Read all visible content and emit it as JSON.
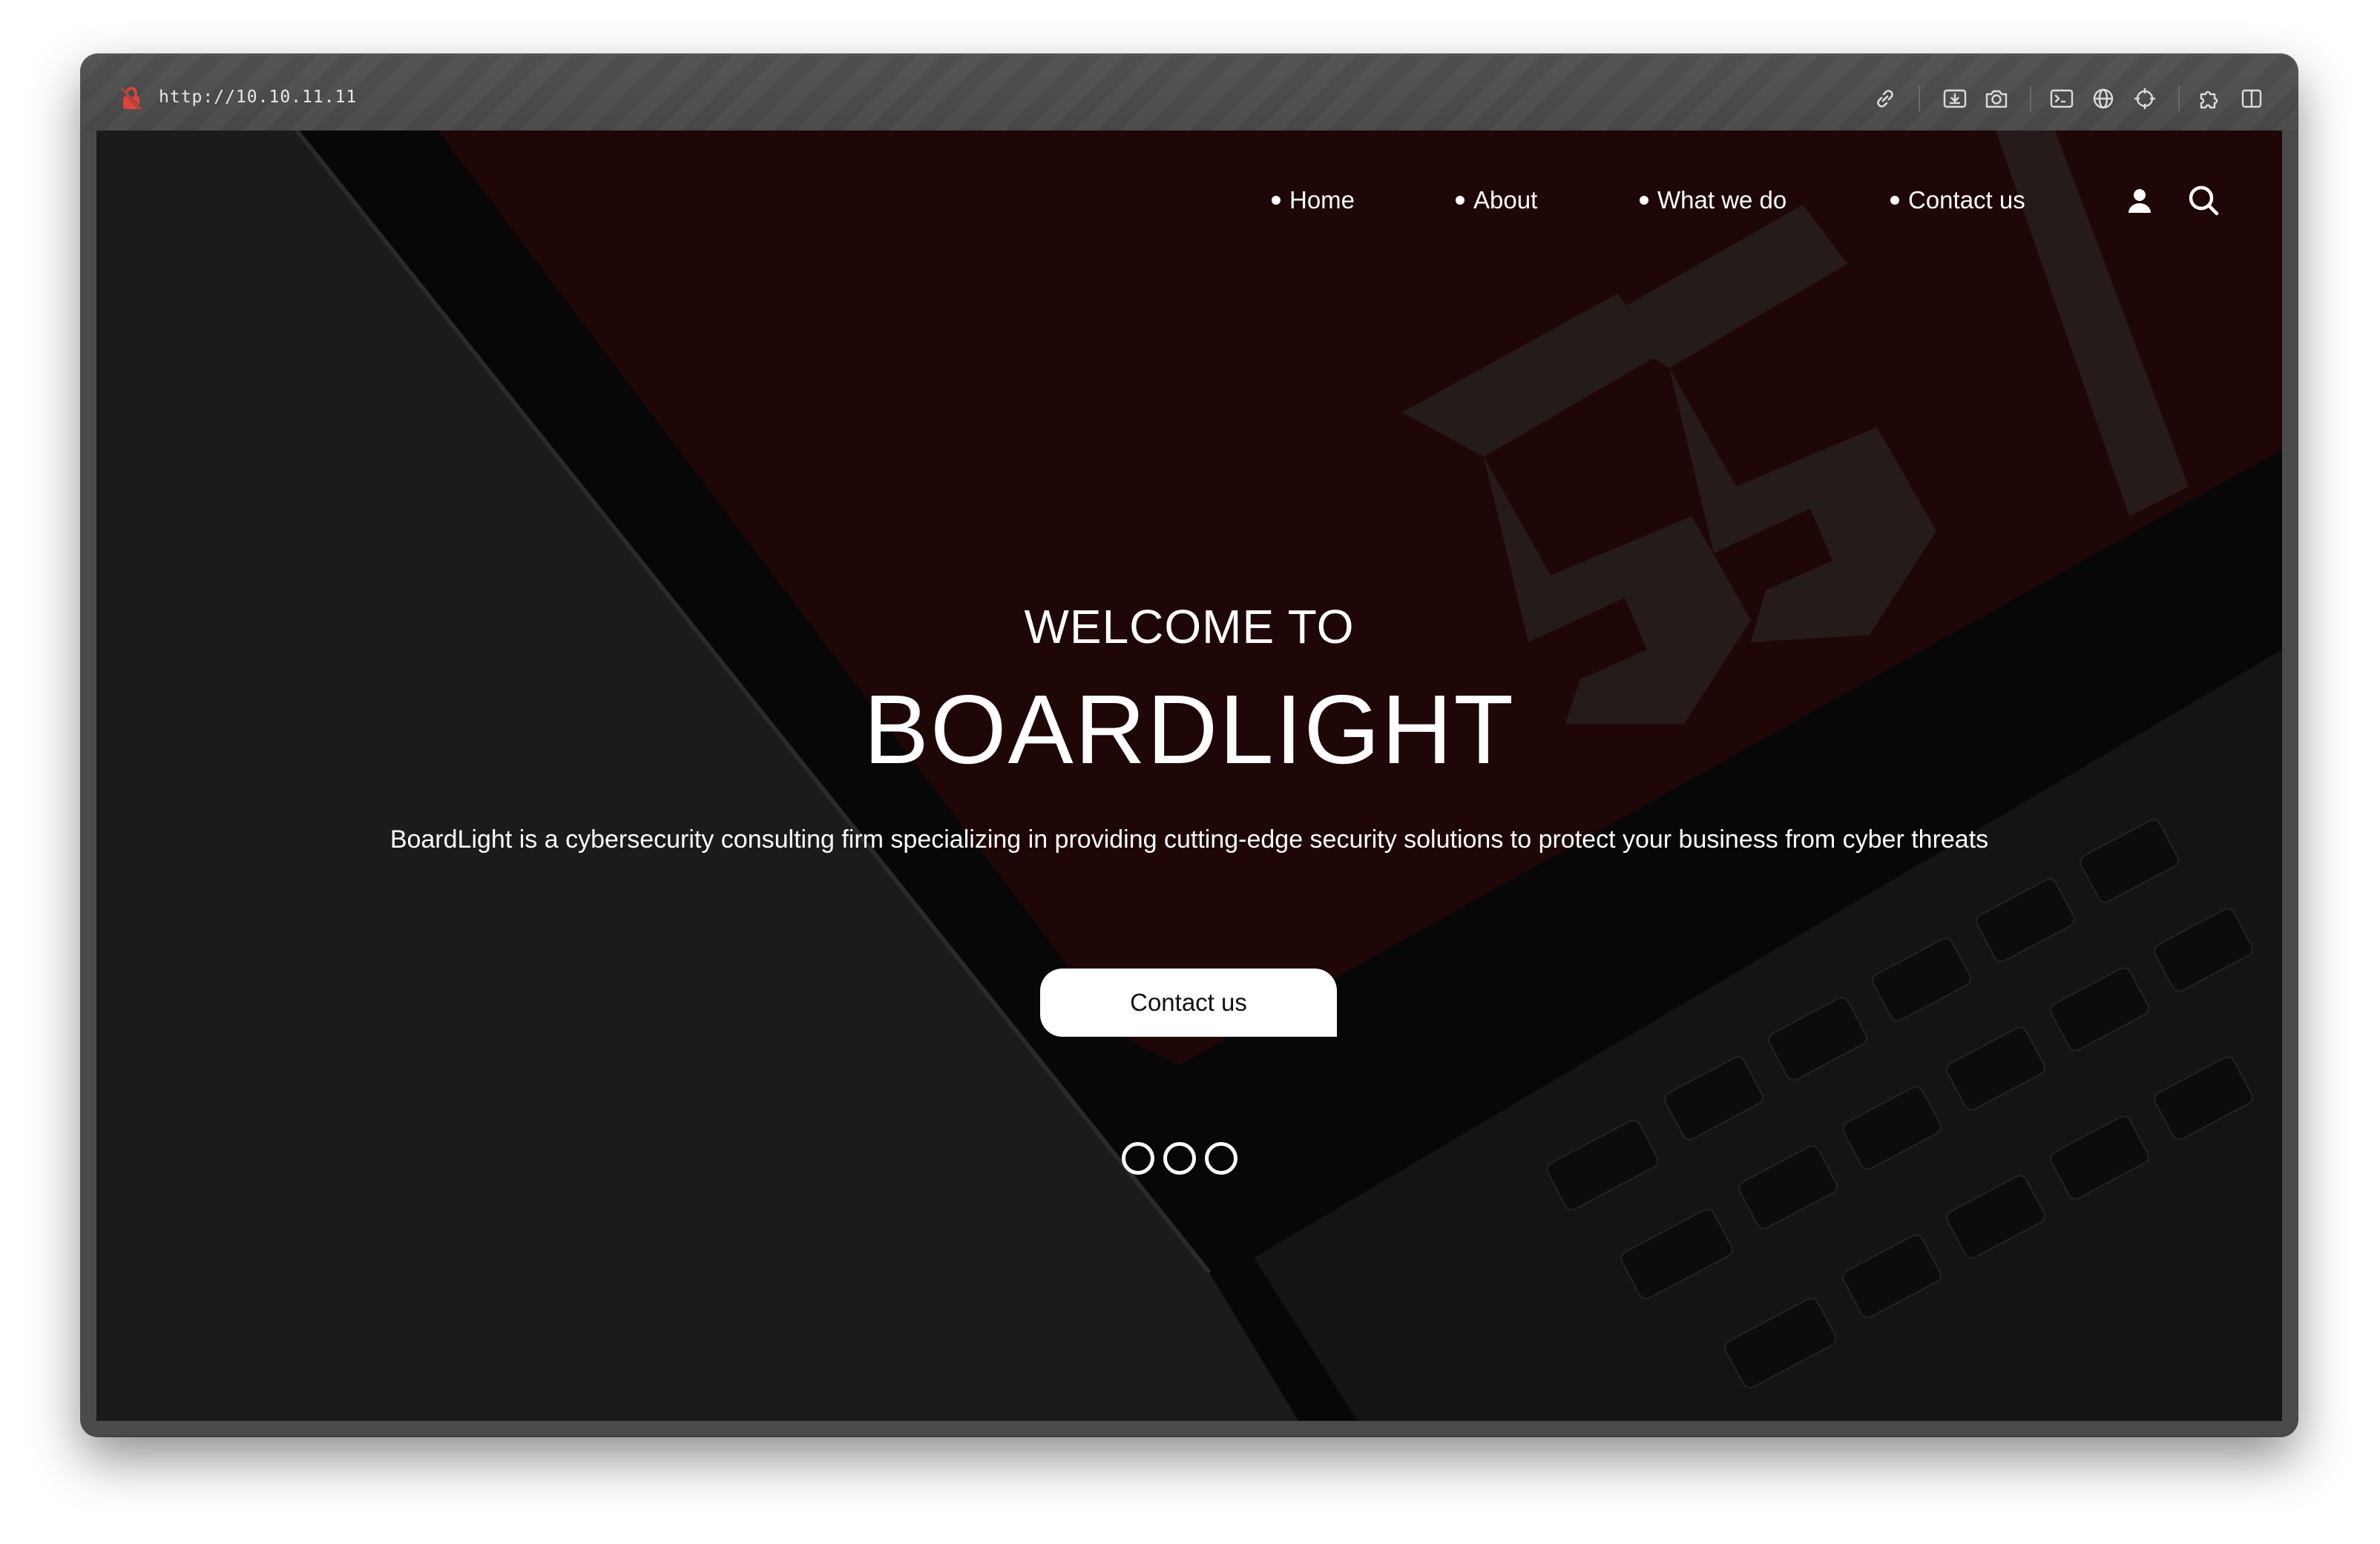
{
  "browser": {
    "url": "http://10.10.11.11",
    "icons": [
      "lock-slash-icon",
      "link-icon",
      "download-screenshot-icon",
      "camera-icon",
      "terminal-icon",
      "globe-icon",
      "crosshair-icon",
      "extensions-icon",
      "split-view-icon"
    ]
  },
  "nav": {
    "items": [
      {
        "label": "Home"
      },
      {
        "label": "About"
      },
      {
        "label": "What we do"
      },
      {
        "label": "Contact us"
      }
    ],
    "icons": [
      "user-icon",
      "search-icon"
    ]
  },
  "hero": {
    "subtitle": "WELCOME TO",
    "title": "BOARDLIGHT",
    "description": "BoardLight is a cybersecurity consulting firm specializing in providing cutting-edge security solutions to protect your business from cyber threats",
    "cta_label": "Contact us",
    "slide_count": 3
  },
  "colors": {
    "page_bg": "#1b1b1b",
    "screen_red": "#1f0708",
    "text": "#ffffff"
  }
}
